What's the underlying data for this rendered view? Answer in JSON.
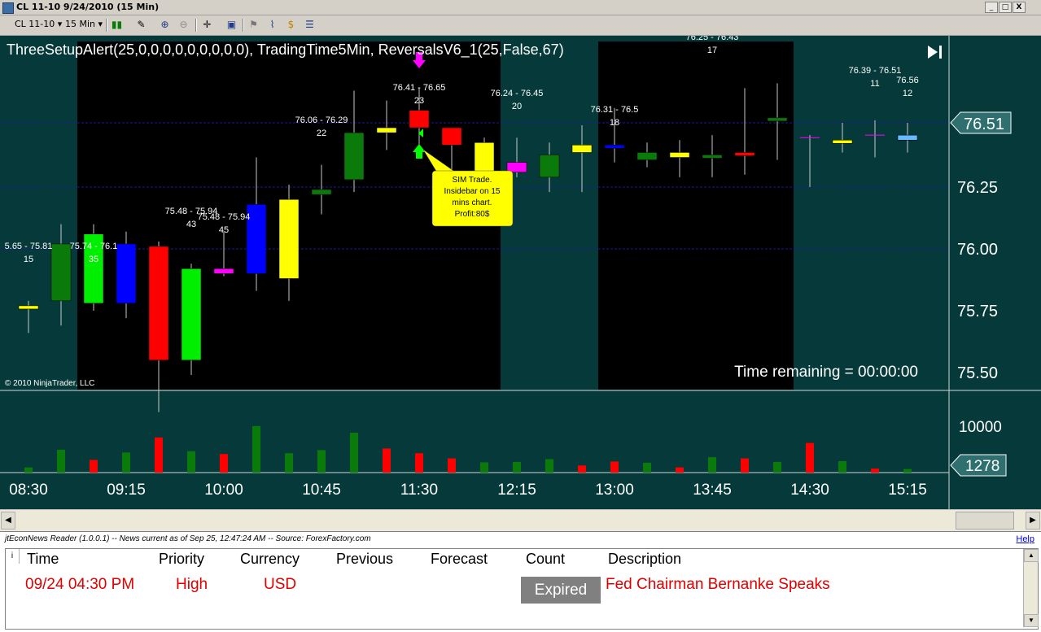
{
  "window": {
    "title": "CL 11-10  9/24/2010 (15 Min)",
    "buttons": {
      "min": "_",
      "max": "□",
      "close": "X"
    }
  },
  "toolbar": {
    "instrument": "CL 11-10",
    "interval": "15 Min"
  },
  "chart": {
    "indicator_label": "ThreeSetupAlert(25,0,0,0,0,0,0,0,0,0), TradingTime5Min, ReversalsV6_1(25,False,67)",
    "copyright": "© 2010 NinjaTrader, LLC",
    "time_remaining": "Time remaining = 00:00:00",
    "price_axis": [
      "76.25",
      "76.00",
      "75.75",
      "75.50"
    ],
    "current_price": "76.51",
    "volume_axis": "10000",
    "current_volume": "1278",
    "time_axis": [
      "08:30",
      "09:15",
      "10:00",
      "10:45",
      "11:30",
      "12:15",
      "13:00",
      "13:45",
      "14:30",
      "15:15"
    ],
    "colors": {
      "background": "#063a3a",
      "session": "#000000",
      "up": "#0a7a0a",
      "down": "#ff0000",
      "green_bright": "#00ee00",
      "yellow": "#ffff00",
      "blue": "#0000ff",
      "magenta": "#ff00ff"
    },
    "annotations": [
      {
        "range": "5.65 - 75.81",
        "count": "15"
      },
      {
        "range": "75.74 - 76.1",
        "count": "35"
      },
      {
        "range": "75.48 - 75.94",
        "count": "43"
      },
      {
        "range": "75.48 - 75.94",
        "count": "45"
      },
      {
        "range": "76.06 - 76.29",
        "count": "22"
      },
      {
        "range": "76.41 - 76.65",
        "count": "23"
      },
      {
        "range": "76.24 - 76.45",
        "count": "20"
      },
      {
        "range": "76.31 - 76.5",
        "count": "18"
      },
      {
        "range": "76.25 - 76.43",
        "count": "17"
      },
      {
        "range": "76.39 - 76.51",
        "count": "11"
      },
      {
        "range": "76.56",
        "count": "12"
      }
    ],
    "callout_lines": [
      "SIM Trade.",
      "Insidebar on 15",
      "mins chart.",
      "Profit:80$"
    ]
  },
  "chart_data": {
    "type": "candlestick",
    "x": [
      "08:30",
      "08:45",
      "09:00",
      "09:15",
      "09:30",
      "09:45",
      "10:00",
      "10:15",
      "10:30",
      "10:45",
      "11:00",
      "11:15",
      "11:30",
      "11:45",
      "12:00",
      "12:15",
      "12:30",
      "12:45",
      "13:00",
      "13:15",
      "13:30",
      "13:45",
      "14:00",
      "14:15",
      "14:30",
      "14:45",
      "15:00",
      "15:15"
    ],
    "open": [
      75.77,
      75.79,
      75.78,
      75.78,
      76.01,
      75.55,
      75.92,
      75.9,
      75.88,
      76.22,
      76.28,
      76.47,
      76.49,
      76.49,
      76.3,
      76.31,
      76.29,
      76.39,
      76.42,
      76.39,
      76.37,
      76.38,
      76.39,
      76.53,
      76.38,
      76.44,
      76.44,
      76.46
    ],
    "close": [
      75.77,
      76.02,
      76.06,
      76.02,
      75.55,
      75.92,
      75.9,
      76.18,
      76.2,
      76.24,
      76.47,
      76.49,
      76.56,
      76.42,
      76.43,
      76.35,
      76.38,
      76.42,
      76.41,
      76.36,
      76.39,
      76.37,
      76.39,
      76.53,
      76.45,
      76.44,
      76.46,
      76.44
    ],
    "high": [
      75.79,
      76.1,
      76.1,
      76.07,
      76.03,
      75.94,
      76.07,
      76.37,
      76.26,
      76.34,
      76.64,
      76.6,
      76.65,
      76.48,
      76.45,
      76.45,
      76.43,
      76.5,
      76.57,
      76.43,
      76.44,
      76.46,
      76.65,
      76.67,
      76.46,
      76.51,
      76.52,
      76.51
    ],
    "low": [
      75.66,
      75.69,
      75.75,
      75.72,
      75.34,
      75.49,
      75.89,
      75.83,
      75.79,
      76.14,
      76.23,
      76.4,
      76.41,
      76.29,
      76.28,
      76.29,
      76.23,
      76.23,
      76.35,
      76.33,
      76.29,
      76.29,
      76.3,
      76.36,
      76.25,
      76.39,
      76.37,
      76.39
    ],
    "volume_axis_value": 10000,
    "volume_last": 1278,
    "volume": [
      1300,
      5800,
      3200,
      5100,
      8900,
      5400,
      4700,
      11800,
      4900,
      5700,
      10100,
      6100,
      4900,
      3600,
      2600,
      2700,
      3400,
      1800,
      2800,
      2500,
      1300,
      3900,
      3600,
      2700,
      7500,
      2900,
      1000,
      900
    ],
    "volume_direction": [
      "up",
      "up",
      "down",
      "up",
      "down",
      "up",
      "down",
      "up",
      "up",
      "up",
      "up",
      "down",
      "down",
      "down",
      "up",
      "up",
      "up",
      "down",
      "down",
      "up",
      "down",
      "up",
      "down",
      "up",
      "down",
      "up",
      "down",
      "up"
    ]
  },
  "scroll": {
    "left": "◀",
    "right": "▶"
  },
  "news": {
    "header": "jtEconNews Reader (1.0.0.1)  --  News current as of Sep 25, 12:47:24 AM  --  Source: ForexFactory.com",
    "help": "Help",
    "info_icon": "i",
    "columns": [
      "Time",
      "Priority",
      "Currency",
      "Previous",
      "Forecast",
      "Count",
      "Description"
    ],
    "row": {
      "time": "09/24 04:30 PM",
      "priority": "High",
      "currency": "USD",
      "count": "Expired",
      "description": "Fed Chairman Bernanke Speaks"
    }
  }
}
